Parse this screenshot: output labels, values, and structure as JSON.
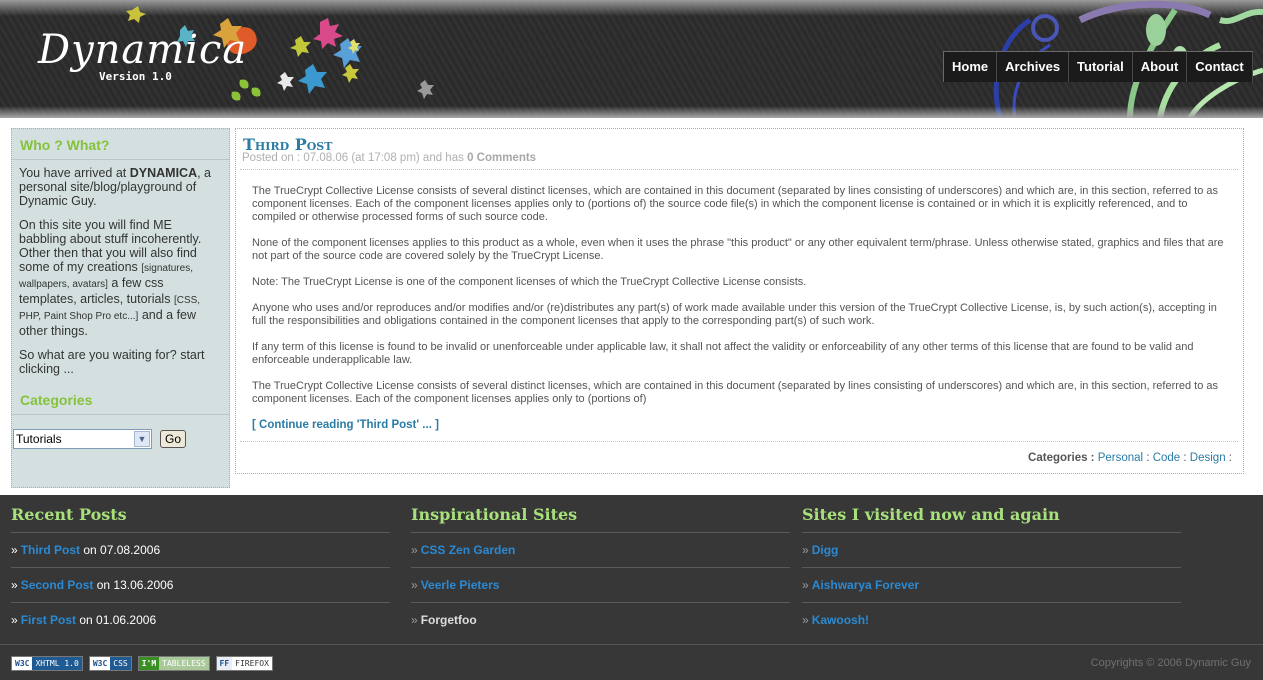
{
  "header": {
    "logo_text": "Dynamica",
    "version_text": "Version 1.0"
  },
  "nav": {
    "items": [
      {
        "label": "Home"
      },
      {
        "label": "Archives"
      },
      {
        "label": "Tutorial"
      },
      {
        "label": "About"
      },
      {
        "label": "Contact"
      }
    ]
  },
  "sidebar": {
    "heading": "Who ? What?",
    "intro_prefix": "You have arrived at",
    "intro_name": "DYNAMICA",
    "intro_suffix": ", a personal site/blog/playground of Dynamic Guy.",
    "para2_a": "On this site you will find ME babbling about stuff incoherently. Other then that you will also find some of my creations",
    "para2_b": "[signatures, wallpapers, avatars]",
    "para2_c": "a few css templates, articles, tutorials",
    "para2_d": "[CSS, PHP, Paint Shop Pro etc...]",
    "para2_e": "and a few other things.",
    "para3": "So what are you waiting for? start clicking ...",
    "categories_heading": "Categories",
    "select_value": "Tutorials",
    "go_label": "Go"
  },
  "post": {
    "title": "Third Post",
    "meta_prefix": "Posted on : 07.08.06 (at 17:08 pm) and has",
    "comments": "0 Comments",
    "paragraphs": [
      "The TrueCrypt Collective License consists of several distinct licenses, which are contained in this document (separated by lines consisting of underscores) and which are, in this section, referred to as component licenses. Each of the component licenses applies only to (portions of) the source code file(s) in which the component license is contained or in which it is explicitly referenced, and to compiled or otherwise processed forms of such source code.",
      "None of the component licenses applies to this product as a whole, even when it uses the phrase \"this product\" or any other equivalent term/phrase. Unless otherwise stated, graphics and files that are not part of the source code are covered solely by the TrueCrypt License.",
      "Note: The TrueCrypt License is one of the component licenses of which the TrueCrypt Collective License consists.",
      "Anyone who uses and/or reproduces and/or modifies and/or (re)distributes any part(s) of work made available under this version of the TrueCrypt Collective License, is, by such action(s), accepting in full the responsibilities and obligations contained in the component licenses that apply to the corresponding part(s) of such work.",
      "If any term of this license is found to be invalid or unenforceable under applicable law, it shall not affect the validity or enforceability of any other terms of this license that are found to be valid and enforceable underapplicable law.",
      "The TrueCrypt Collective License consists of several distinct licenses, which are contained in this document (separated by lines consisting of underscores) and which are, in this section, referred to as component licenses. Each of the component licenses applies only to (portions of)"
    ],
    "continue_link": "[ Continue reading 'Third Post' ... ]",
    "categories_label": "Categories :",
    "categories": [
      "Personal",
      "Code",
      "Design"
    ]
  },
  "footer": {
    "recent": {
      "heading": "Recent Posts",
      "items": [
        {
          "title": "Third Post",
          "date": "on 07.08.2006"
        },
        {
          "title": "Second Post",
          "date": "on 13.06.2006"
        },
        {
          "title": "First Post",
          "date": "on 01.06.2006"
        }
      ]
    },
    "inspirational": {
      "heading": "Inspirational Sites",
      "items": [
        "CSS Zen Garden",
        "Veerle Pieters",
        "Forgetfoo"
      ]
    },
    "visited": {
      "heading": "Sites I visited now and again",
      "items": [
        "Digg",
        "Aishwarya Forever",
        "Kawoosh!"
      ]
    },
    "badges": [
      {
        "left": "W3C",
        "right": "XHTML 1.0"
      },
      {
        "left": "W3C",
        "right": "CSS"
      },
      {
        "left": "I'M",
        "right": "TABLELESS"
      },
      {
        "left": "FF",
        "right": "FIREFOX"
      }
    ],
    "copyright": "Copyrights © 2006 Dynamic Guy"
  }
}
